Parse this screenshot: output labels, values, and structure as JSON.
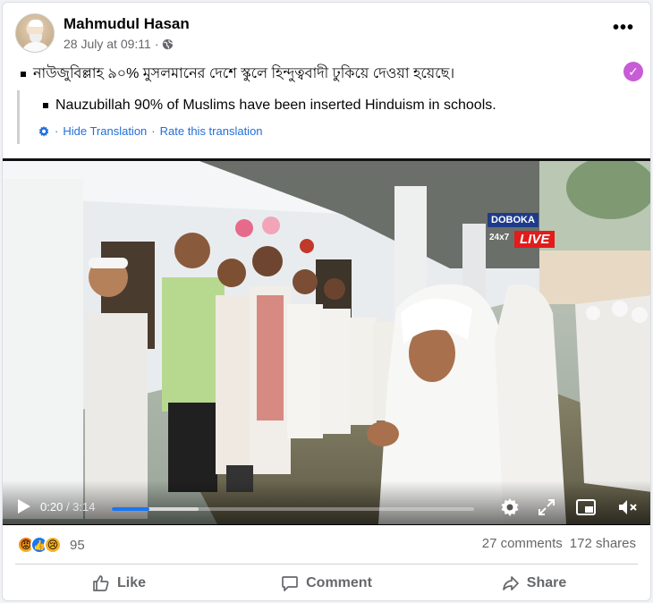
{
  "post": {
    "author": "Mahmudul Hasan",
    "timestamp": "28 July at 09:11",
    "separator": "·",
    "privacy_icon": "globe-icon",
    "more_label": "•••",
    "original_text": "নাউজুবিল্লাহ ৯০% মুসলমানের দেশে স্কুলে হিন্দুত্ববাদী ঢুকিয়ে দেওয়া হয়েছে।",
    "translated_text": "Nauzubillah 90% of Muslims have been inserted Hinduism in schools.",
    "hide_translation": "Hide Translation",
    "link_separator": "·",
    "rate_translation": "Rate this translation"
  },
  "video": {
    "channel_logo_top": "DOBOKA",
    "channel_logo_24": "24x7",
    "channel_logo_live": "LIVE",
    "current_time": "0:20",
    "duration": "/ 3:14",
    "progress_fraction": 0.103,
    "buffered_fraction": 0.24
  },
  "engagement": {
    "reaction_icons": [
      "angry-icon",
      "like-icon",
      "sad-icon"
    ],
    "reaction_count": "95",
    "comments": "27 comments",
    "shares": "172 shares"
  },
  "actions": {
    "like": "Like",
    "comment": "Comment",
    "share": "Share"
  },
  "colors": {
    "link_blue": "#216fdb",
    "fb_blue": "#1877f2",
    "muted_text": "#65676b",
    "badge_purple": "#c85bd6"
  }
}
